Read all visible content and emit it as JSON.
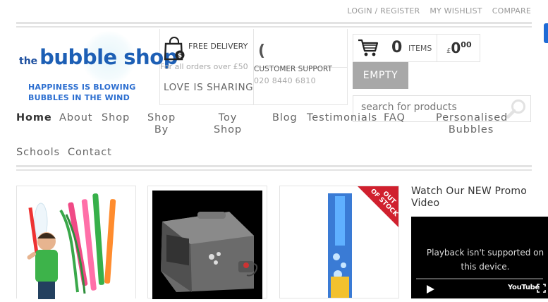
{
  "top_links": {
    "login": "LOGIN / REGISTER",
    "wishlist": "MY WISHLIST",
    "compare": "COMPARE"
  },
  "logo": {
    "prefix": "the",
    "name": "bubble shop"
  },
  "tagline": {
    "line1": "HAPPINESS IS BLOWING",
    "line2": "BUBBLES IN THE WIND"
  },
  "delivery": {
    "title": "FREE DELIVERY",
    "subtitle": "For all orders over £50",
    "slogan": "LOVE IS SHARING"
  },
  "support": {
    "label": "CUSTOMER SUPPORT",
    "phone": "020 8440 6810"
  },
  "cart": {
    "count": "0",
    "items_label": "ITEMS",
    "currency": "£",
    "amount": "0",
    "pence": "00",
    "empty_label": "EMPTY"
  },
  "search": {
    "placeholder": "search for products"
  },
  "nav": {
    "home": "Home",
    "about": "About",
    "shop": "Shop",
    "shop_by": {
      "line1": "Shop",
      "line2": "By"
    },
    "toy_shop": {
      "line1": "Toy",
      "line2": "Shop"
    },
    "blog": "Blog",
    "testimonials": "Testimonials",
    "faq": "FAQ",
    "personalised": {
      "line1": "Personalised",
      "line2": "Bubbles"
    },
    "schools": "Schools",
    "contact": "Contact"
  },
  "products": [
    {
      "image": "boy-with-bubble-wands-photo"
    },
    {
      "image": "bubble-machine-photo"
    },
    {
      "image": "bubble-sword-photo",
      "badge": {
        "line1": "OUT",
        "line2": "OF STOCK"
      }
    }
  ],
  "promo": {
    "title_line1": "Watch Our NEW Promo",
    "title_line2": "Video",
    "message_line1": "Playback isn't supported on",
    "message_line2": "this device.",
    "player_brand": "YouTube"
  },
  "colors": {
    "brand_blue": "#1d5fb5",
    "badge_red": "#d0202e",
    "button_grey": "#a8a8a8"
  }
}
